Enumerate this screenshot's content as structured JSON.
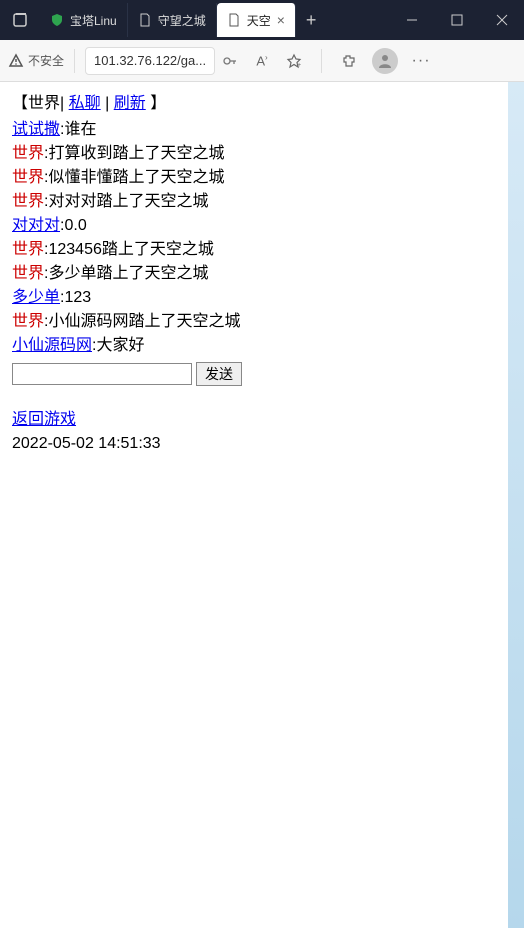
{
  "browser": {
    "tabs": [
      {
        "label": "宝塔Linu",
        "favicon_color": "#2ea44f"
      },
      {
        "label": "守望之城",
        "favicon_color": "#fff"
      },
      {
        "label": "天空",
        "favicon_color": "#333"
      }
    ],
    "new_tab_label": "+",
    "insecure_label": "不安全",
    "url": "101.32.76.122/ga..."
  },
  "chat": {
    "header": {
      "prefix": "【",
      "world": "世界",
      "sep1": "|",
      "private": "私聊",
      "sep2": "|",
      "refresh": "刷新",
      "suffix": "】"
    },
    "messages": [
      {
        "user": "试试撒",
        "userClass": "link",
        "colon": ":",
        "text": "谁在"
      },
      {
        "user": "世界",
        "userClass": "world",
        "colon": ":",
        "text": "打算收到踏上了天空之城"
      },
      {
        "user": "世界",
        "userClass": "world",
        "colon": ":",
        "text": "似懂非懂踏上了天空之城"
      },
      {
        "user": "世界",
        "userClass": "world",
        "colon": ":",
        "text": "对对对踏上了天空之城"
      },
      {
        "user": "对对对",
        "userClass": "link",
        "colon": ":",
        "text": "0.0"
      },
      {
        "user": "世界",
        "userClass": "world",
        "colon": ":",
        "text": "123456踏上了天空之城"
      },
      {
        "user": "世界",
        "userClass": "world",
        "colon": ":",
        "text": "多少单踏上了天空之城"
      },
      {
        "user": "多少单",
        "userClass": "link",
        "colon": ":",
        "text": "123"
      },
      {
        "user": "世界",
        "userClass": "world",
        "colon": ":",
        "text": "小仙源码网踏上了天空之城"
      },
      {
        "user": "小仙源码网",
        "userClass": "link",
        "colon": ":",
        "text": "大家好"
      }
    ],
    "send_button": "发送",
    "input_value": "",
    "back_game": "返回游戏",
    "timestamp": "2022-05-02 14:51:33"
  }
}
